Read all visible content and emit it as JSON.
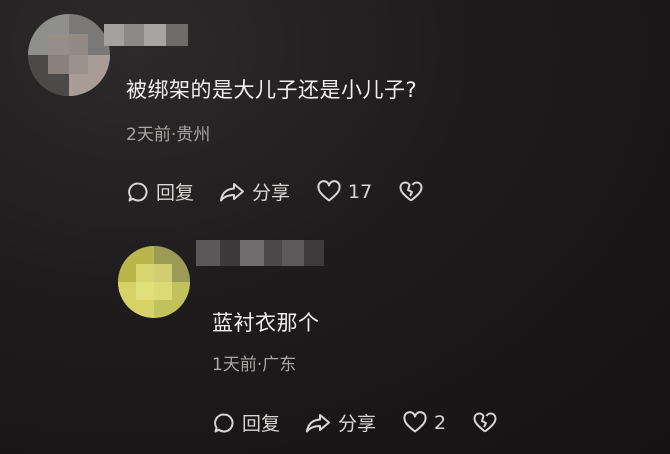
{
  "comments": [
    {
      "text": "被绑架的是大儿子还是小儿子?",
      "meta": "2天前·贵州",
      "reply_label": "回复",
      "share_label": "分享",
      "like_count": "17"
    },
    {
      "text": "蓝衬衣那个",
      "meta": "1天前·广东",
      "reply_label": "回复",
      "share_label": "分享",
      "like_count": "2"
    }
  ],
  "icons": [
    "reply-icon",
    "share-icon",
    "heart-icon",
    "broken-heart-icon"
  ]
}
